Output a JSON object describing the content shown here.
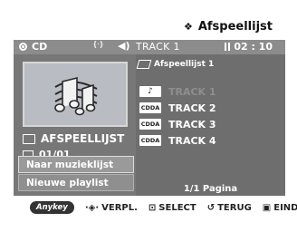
{
  "header": {
    "title": "Afspeellijst",
    "icon": "playlist-icon"
  },
  "status": {
    "disc": "CD",
    "audio_indicator": "(ᐧ)",
    "track": "TRACK  1",
    "time": "02 : 10"
  },
  "left_panel": {
    "folder_label": "AFSPEELLIJST",
    "date_label": "01/01",
    "menu": [
      {
        "label": "Naar muzieklijst",
        "selected": true
      },
      {
        "label": "Nieuwe playlist",
        "selected": false
      }
    ]
  },
  "right_panel": {
    "playlist_title": "Afspeellijst 1",
    "tracks": [
      {
        "tag": "♪",
        "label": "TRACK 1",
        "dim": true
      },
      {
        "tag": "CDDA",
        "label": "TRACK 2",
        "dim": false
      },
      {
        "tag": "CDDA",
        "label": "TRACK 3",
        "dim": false
      },
      {
        "tag": "CDDA",
        "label": "TRACK 4",
        "dim": false
      }
    ],
    "page": "1/1 Pagina"
  },
  "footer": {
    "anykey": "Anykey",
    "move": "VERPL.",
    "select": "SELECT",
    "back": "TERUG",
    "end": "EINDE"
  }
}
